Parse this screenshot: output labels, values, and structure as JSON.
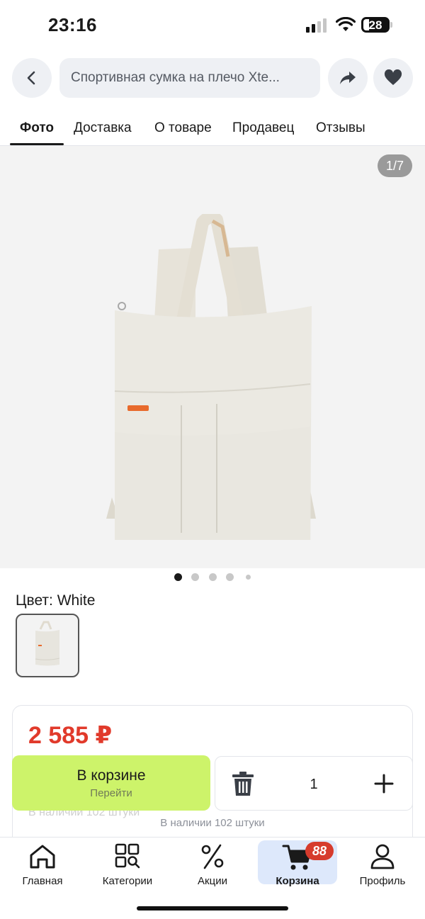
{
  "status_bar": {
    "time": "23:16",
    "battery": "28"
  },
  "header": {
    "search_text": "Спортивная сумка на плечо Xte...",
    "icons": {
      "back": "chevron-left-icon",
      "share": "share-icon",
      "favorite": "heart-icon"
    }
  },
  "tabs": [
    {
      "label": "Фото",
      "active": true
    },
    {
      "label": "Доставка"
    },
    {
      "label": "О товаре"
    },
    {
      "label": "Продавец"
    },
    {
      "label": "Отзывы"
    }
  ],
  "gallery": {
    "counter": "1/7",
    "dots_total": 5,
    "current_index": 0
  },
  "color": {
    "label": "Цвет: White"
  },
  "purchase": {
    "price": "2 585 ₽",
    "cart_button": {
      "title": "В корзине",
      "subtitle": "Перейти"
    },
    "quantity": "1",
    "ghost_stock": "В наличии 102 штуки",
    "stock": "В наличии 102 штуки"
  },
  "bottom_nav": {
    "items": [
      {
        "label": "Главная",
        "icon": "home-icon"
      },
      {
        "label": "Категории",
        "icon": "categories-icon"
      },
      {
        "label": "Акции",
        "icon": "percent-icon"
      },
      {
        "label": "Корзина",
        "icon": "cart-icon",
        "active": true,
        "badge": "88"
      },
      {
        "label": "Профиль",
        "icon": "profile-icon"
      }
    ]
  },
  "colors": {
    "accent_green": "#cdf36a",
    "price_red": "#e13a2b",
    "badge_red": "#d63b2d",
    "active_nav_bg": "#dde8fb"
  }
}
